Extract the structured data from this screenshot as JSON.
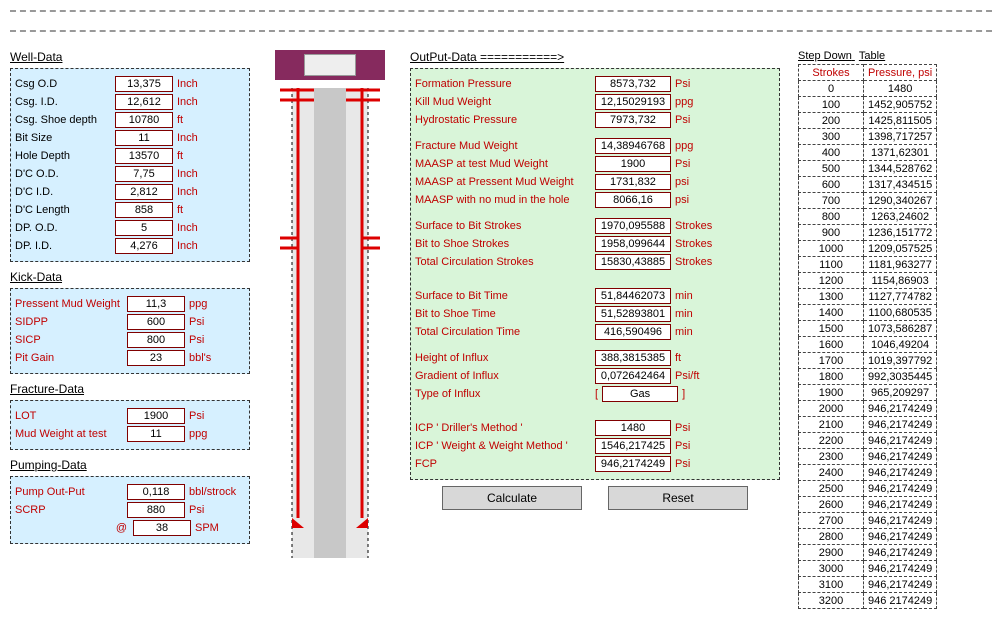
{
  "wellData": {
    "title": "Well-Data",
    "rows": [
      {
        "label": "Csg O.D",
        "value": "13,375",
        "unit": "Inch"
      },
      {
        "label": "Csg. I.D.",
        "value": "12,612",
        "unit": "Inch"
      },
      {
        "label": "Csg. Shoe depth",
        "value": "10780",
        "unit": "ft"
      },
      {
        "label": "Bit Size",
        "value": "11",
        "unit": "Inch"
      },
      {
        "label": "Hole Depth",
        "value": "13570",
        "unit": "ft"
      },
      {
        "label": "D'C O.D.",
        "value": "7,75",
        "unit": "Inch"
      },
      {
        "label": "D'C I.D.",
        "value": "2,812",
        "unit": "Inch"
      },
      {
        "label": "D'C Length",
        "value": "858",
        "unit": "ft"
      },
      {
        "label": "DP. O.D.",
        "value": "5",
        "unit": "Inch"
      },
      {
        "label": "DP. I.D.",
        "value": "4,276",
        "unit": "Inch"
      }
    ]
  },
  "kickData": {
    "title": "Kick-Data",
    "rows": [
      {
        "label": "Pressent Mud Weight",
        "value": "11,3",
        "unit": "ppg"
      },
      {
        "label": "SIDPP",
        "value": "600",
        "unit": "Psi"
      },
      {
        "label": "SICP",
        "value": "800",
        "unit": "Psi"
      },
      {
        "label": "Pit Gain",
        "value": "23",
        "unit": "bbl's"
      }
    ]
  },
  "fractureData": {
    "title": "Fracture-Data",
    "rows": [
      {
        "label": "LOT",
        "value": "1900",
        "unit": "Psi"
      },
      {
        "label": "Mud Weight at test",
        "value": "11",
        "unit": "ppg"
      }
    ]
  },
  "pumpingData": {
    "title": "Pumping-Data",
    "rows": [
      {
        "label": "Pump Out-Put",
        "value": "0,118",
        "unit": "bbl/strock"
      },
      {
        "label": "SCRP",
        "value": "880",
        "unit": "Psi"
      },
      {
        "label": "@",
        "value": "38",
        "unit": "SPM",
        "atRow": true
      }
    ]
  },
  "output": {
    "title": "OutPut-Data ===========>",
    "rows": [
      {
        "label": "Formation Pressure",
        "value": "8573,732",
        "unit": "Psi"
      },
      {
        "label": "Kill Mud Weight",
        "value": "12,15029193",
        "unit": "ppg"
      },
      {
        "label": "Hydrostatic Pressure",
        "value": "7973,732",
        "unit": "Psi"
      },
      {
        "gap": true
      },
      {
        "label": "Fracture Mud Weight",
        "value": "14,38946768",
        "unit": "ppg"
      },
      {
        "label": "MAASP at test Mud Weight",
        "value": "1900",
        "unit": "Psi"
      },
      {
        "label": "MAASP at Pressent Mud Weight",
        "value": "1731,832",
        "unit": "psi"
      },
      {
        "label": "MAASP with no mud in the hole",
        "value": "8066,16",
        "unit": "psi"
      },
      {
        "gap": true
      },
      {
        "label": "Surface to Bit Strokes",
        "value": "1970,095588",
        "unit": "Strokes"
      },
      {
        "label": "Bit to Shoe Strokes",
        "value": "1958,099644",
        "unit": "Strokes"
      },
      {
        "label": "Total Circulation Strokes",
        "value": "15830,43885",
        "unit": "Strokes"
      },
      {
        "gap": true
      },
      {
        "gap": true
      },
      {
        "label": "Surface to Bit Time",
        "value": "51,84462073",
        "unit": "min"
      },
      {
        "label": "Bit to Shoe Time",
        "value": "51,52893801",
        "unit": "min"
      },
      {
        "label": "Total Circulation Time",
        "value": "416,590496",
        "unit": "min"
      },
      {
        "gap": true
      },
      {
        "label": "Height of Influx",
        "value": "388,3815385",
        "unit": "ft"
      },
      {
        "label": "Gradient of Influx",
        "value": "0,072642464",
        "unit": "Psi/ft"
      },
      {
        "label": "Type of Influx",
        "value": "Gas",
        "unit": "",
        "bracket": true
      },
      {
        "gap": true
      },
      {
        "gap": true
      },
      {
        "label": "ICP  ' Driller's Method '",
        "value": "1480",
        "unit": "Psi"
      },
      {
        "label": "ICP  ' Weight & Weight Method '",
        "value": "1546,217425",
        "unit": "Psi"
      },
      {
        "label": "FCP",
        "value": "946,2174249",
        "unit": "Psi"
      }
    ],
    "calcLabel": "Calculate",
    "resetLabel": "Reset"
  },
  "stepDown": {
    "title1": "Step Down",
    "title2": "Table",
    "headers": [
      "Strokes",
      "Pressure, psi"
    ],
    "rows": [
      [
        "0",
        "1480"
      ],
      [
        "100",
        "1452,905752"
      ],
      [
        "200",
        "1425,811505"
      ],
      [
        "300",
        "1398,717257"
      ],
      [
        "400",
        "1371,62301"
      ],
      [
        "500",
        "1344,528762"
      ],
      [
        "600",
        "1317,434515"
      ],
      [
        "700",
        "1290,340267"
      ],
      [
        "800",
        "1263,24602"
      ],
      [
        "900",
        "1236,151772"
      ],
      [
        "1000",
        "1209,057525"
      ],
      [
        "1100",
        "1181,963277"
      ],
      [
        "1200",
        "1154,86903"
      ],
      [
        "1300",
        "1127,774782"
      ],
      [
        "1400",
        "1100,680535"
      ],
      [
        "1500",
        "1073,586287"
      ],
      [
        "1600",
        "1046,49204"
      ],
      [
        "1700",
        "1019,397792"
      ],
      [
        "1800",
        "992,3035445"
      ],
      [
        "1900",
        "965,209297"
      ],
      [
        "2000",
        "946,2174249"
      ],
      [
        "2100",
        "946,2174249"
      ],
      [
        "2200",
        "946,2174249"
      ],
      [
        "2300",
        "946,2174249"
      ],
      [
        "2400",
        "946,2174249"
      ],
      [
        "2500",
        "946,2174249"
      ],
      [
        "2600",
        "946,2174249"
      ],
      [
        "2700",
        "946,2174249"
      ],
      [
        "2800",
        "946,2174249"
      ],
      [
        "2900",
        "946,2174249"
      ],
      [
        "3000",
        "946,2174249"
      ],
      [
        "3100",
        "946,2174249"
      ],
      [
        "3200",
        "946 2174249"
      ]
    ]
  }
}
